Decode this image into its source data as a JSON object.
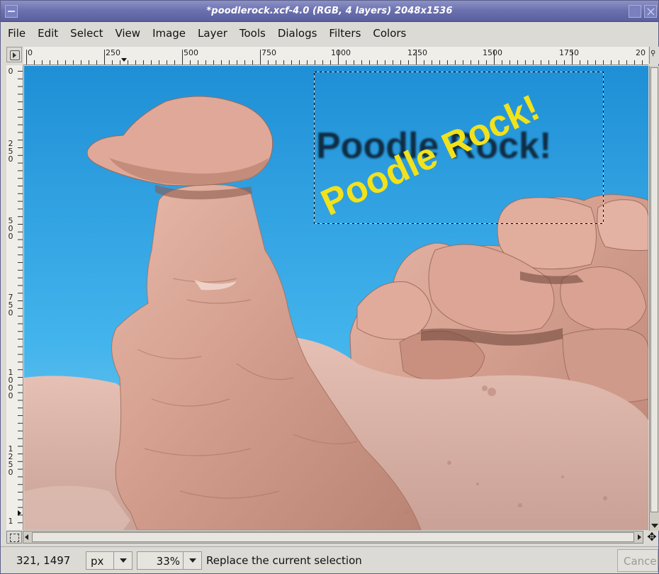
{
  "window": {
    "title": "*poodlerock.xcf-4.0 (RGB, 4 layers) 2048x1536"
  },
  "menubar": {
    "items": [
      "File",
      "Edit",
      "Select",
      "View",
      "Image",
      "Layer",
      "Tools",
      "Dialogs",
      "Filters",
      "Colors"
    ]
  },
  "rulers": {
    "horizontal_labels": [
      "0",
      "250",
      "500",
      "750",
      "1000",
      "1250",
      "1500",
      "1750",
      "20"
    ],
    "vertical_labels": [
      "0",
      "250",
      "500",
      "750",
      "1000",
      "1250",
      "1"
    ]
  },
  "canvas": {
    "text_dark": "Poodle Rock!",
    "text_yellow": "Poodle Rock!",
    "sky_color": "#3aa6e0",
    "rock_color": "#d9a898",
    "text_yellow_color": "#f2e21a",
    "text_dark_color": "#0c2236"
  },
  "statusbar": {
    "coords": "321, 1497",
    "unit": "px",
    "zoom": "33%",
    "message": "Replace the current selection",
    "cancel_label": "Cancel"
  },
  "icons": {
    "navigate": "✥"
  }
}
